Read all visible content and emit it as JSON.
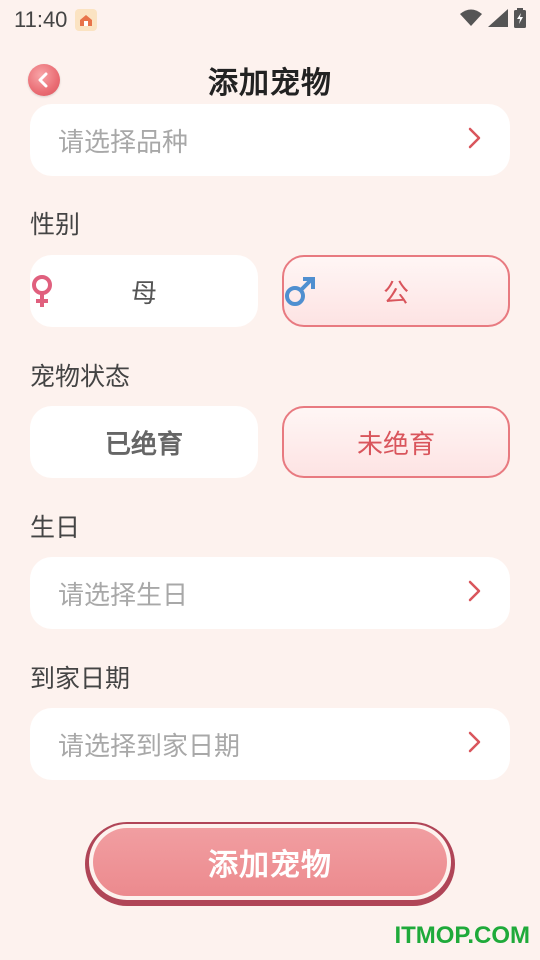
{
  "status_bar": {
    "time": "11:40"
  },
  "header": {
    "title": "添加宠物"
  },
  "breed": {
    "placeholder": "请选择品种"
  },
  "gender": {
    "label": "性别",
    "options": [
      {
        "label": "母",
        "icon": "female-icon",
        "selected": false
      },
      {
        "label": "公",
        "icon": "male-icon",
        "selected": true
      }
    ]
  },
  "pet_status": {
    "label": "宠物状态",
    "options": [
      {
        "label": "已绝育",
        "selected": false
      },
      {
        "label": "未绝育",
        "selected": true
      }
    ]
  },
  "birthday": {
    "label": "生日",
    "placeholder": "请选择生日"
  },
  "arrival_date": {
    "label": "到家日期",
    "placeholder": "请选择到家日期"
  },
  "submit": {
    "label": "添加宠物"
  },
  "watermark": "ITMOP.COM",
  "colors": {
    "background": "#fdf2ee",
    "accent": "#e87a80",
    "button": "#ec8a8e",
    "button_border": "#b04557"
  }
}
